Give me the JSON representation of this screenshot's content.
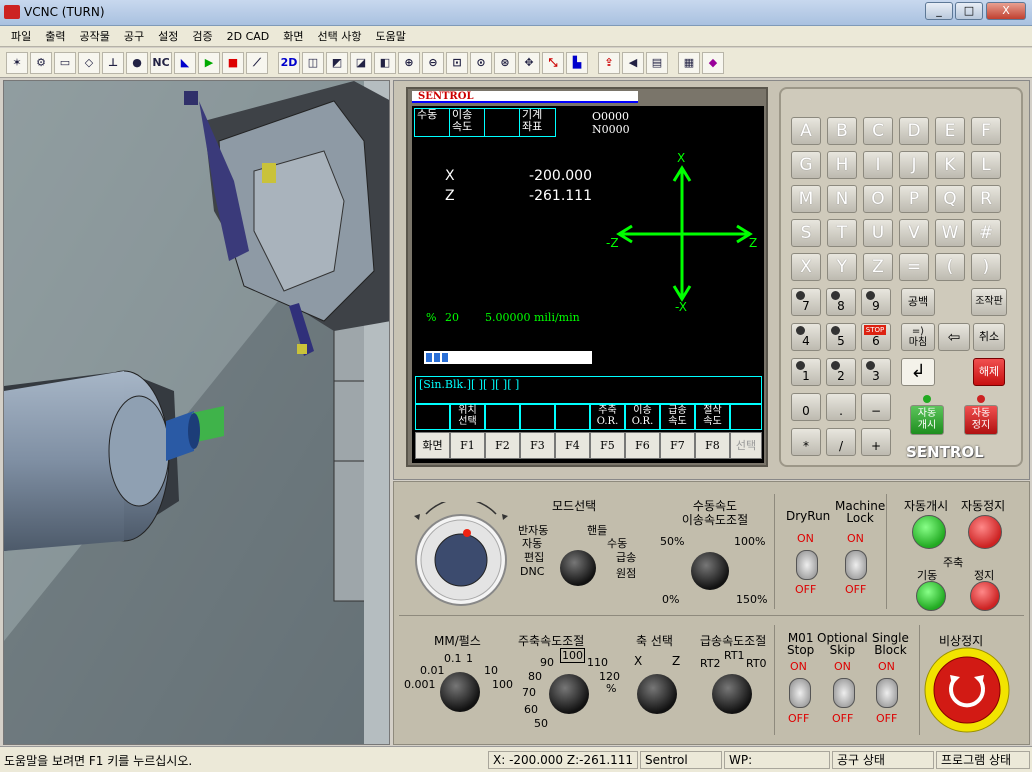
{
  "window": {
    "title": "VCNC (TURN)",
    "min": "_",
    "max": "□",
    "close": "X"
  },
  "menu": [
    "파일",
    "출력",
    "공작물",
    "공구",
    "설정",
    "검증",
    "2D CAD",
    "화면",
    "선택 사항",
    "도움말"
  ],
  "toolbar": {
    "nc_label": "NC",
    "twod_label": "2D"
  },
  "screen": {
    "brand": "SENTROL",
    "mode_cells": [
      "수동",
      "이송\n속도",
      "",
      "기계\n좌표"
    ],
    "program": "O0000",
    "sequence": "N0000",
    "axes": [
      {
        "name": "X",
        "value": "-200.000"
      },
      {
        "name": "Z",
        "value": "-261.111"
      }
    ],
    "axis_labels": {
      "px": "X",
      "nx": "-X",
      "pz": "Z",
      "nz": "-Z"
    },
    "feed_percent": "%",
    "feed_value": "20",
    "feed_rate": "5.00000 mili/min",
    "single_block": "[Sin.Blk.][ ][ ][ ][ ]",
    "softkey_titles": [
      "",
      "위치\n선택",
      "",
      "",
      "",
      "주축\nO.R.",
      "이송\nO.R.",
      "급송\n속도",
      "절삭\n속도",
      ""
    ],
    "softkeys": [
      "화면",
      "F1",
      "F2",
      "F3",
      "F4",
      "F5",
      "F6",
      "F7",
      "F8",
      "선택"
    ]
  },
  "keypad": {
    "letters": [
      "A",
      "B",
      "C",
      "D",
      "E",
      "F",
      "G",
      "H",
      "I",
      "J",
      "K",
      "L",
      "M",
      "N",
      "O",
      "P",
      "Q",
      "R",
      "S",
      "T",
      "U",
      "V",
      "W",
      "#",
      "X",
      "Y",
      "Z",
      "=",
      "(",
      ")"
    ],
    "numbers": [
      "7",
      "8",
      "9",
      "4",
      "5",
      "6",
      "1",
      "2",
      "3",
      "0",
      ".",
      "−",
      "*",
      "/",
      "+"
    ],
    "stop_label": "STOP",
    "space": "공백",
    "panel_btn": "조작판",
    "end_label": "마침",
    "end_sym": "=⟩",
    "back_sym": "⇦",
    "cancel": "취소",
    "release": "해제",
    "enter_sym": "↲",
    "auto_start": "자동\n개시",
    "auto_stop": "자동\n정지",
    "brand": "SENTROL"
  },
  "panel": {
    "mode_title": "모드선택",
    "mode_labels": [
      "반자동",
      "핸들",
      "자동",
      "수동",
      "편집",
      "급송",
      "DNC",
      "원점"
    ],
    "feed_title": "수동속도\n이송속도조절",
    "feed_marks": [
      "50%",
      "100%",
      "0%",
      "150%"
    ],
    "dryrun": "DryRun",
    "machine_lock": "Machine\nLock",
    "on": "ON",
    "off": "OFF",
    "auto_start": "자동개시",
    "auto_stop": "자동정지",
    "spindle": "주축",
    "spindle_start": "기동",
    "spindle_stop": "정지",
    "mm_title": "MM/펄스",
    "mm_marks": [
      "0.1",
      "1",
      "0.01",
      "10",
      "0.001",
      "100"
    ],
    "spindle_title": "주축속도조절",
    "spindle_marks": [
      "100",
      "90",
      "110",
      "80",
      "120",
      "%",
      "70",
      "60",
      "50"
    ],
    "axis_title": "축 선택",
    "axis_marks": [
      "X",
      "Z"
    ],
    "rapid_title": "급송속도조절",
    "rapid_marks": [
      "RT1",
      "RT2",
      "RT0"
    ],
    "m01": "M01\nStop",
    "optional": "Optional\nSkip",
    "single": "Single\nBlock",
    "emergency": "비상정지"
  },
  "status": {
    "help": "도움말을 보려면 F1 키를 누르십시오.",
    "coords": "X: -200.000  Z:-261.111",
    "brand": "Sentrol",
    "wp": "WP:",
    "tool": "공구 상태",
    "program": "프로그램 상태"
  },
  "colors": {
    "screen_bg": "#000000",
    "cyan": "#00ffff",
    "green": "#00ff00",
    "red": "#dd0000"
  }
}
